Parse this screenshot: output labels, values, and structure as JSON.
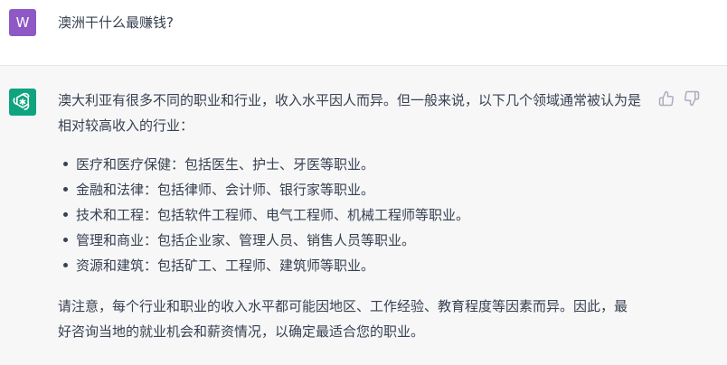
{
  "user": {
    "avatar_letter": "W",
    "avatar_color": "#8e59c5",
    "message": "澳洲干什么最赚钱?"
  },
  "assistant": {
    "avatar_icon": "openai-logo-icon",
    "avatar_color": "#10a37f",
    "intro": "澳大利亚有很多不同的职业和行业，收入水平因人而异。但一般来说，以下几个领域通常被认为是相对较高收入的行业：",
    "bullets": [
      "医疗和医疗保健：包括医生、护士、牙医等职业。",
      "金融和法律：包括律师、会计师、银行家等职业。",
      "技术和工程：包括软件工程师、电气工程师、机械工程师等职业。",
      "管理和商业：包括企业家、管理人员、销售人员等职业。",
      "资源和建筑：包括矿工、工程师、建筑师等职业。"
    ],
    "closing": "请注意，每个行业和职业的收入水平都可能因地区、工作经验、教育程度等因素而异。因此，最好咨询当地的就业机会和薪资情况，以确定最适合您的职业。"
  },
  "feedback": {
    "thumbs_up_icon": "thumbs-up-icon",
    "thumbs_down_icon": "thumbs-down-icon"
  }
}
